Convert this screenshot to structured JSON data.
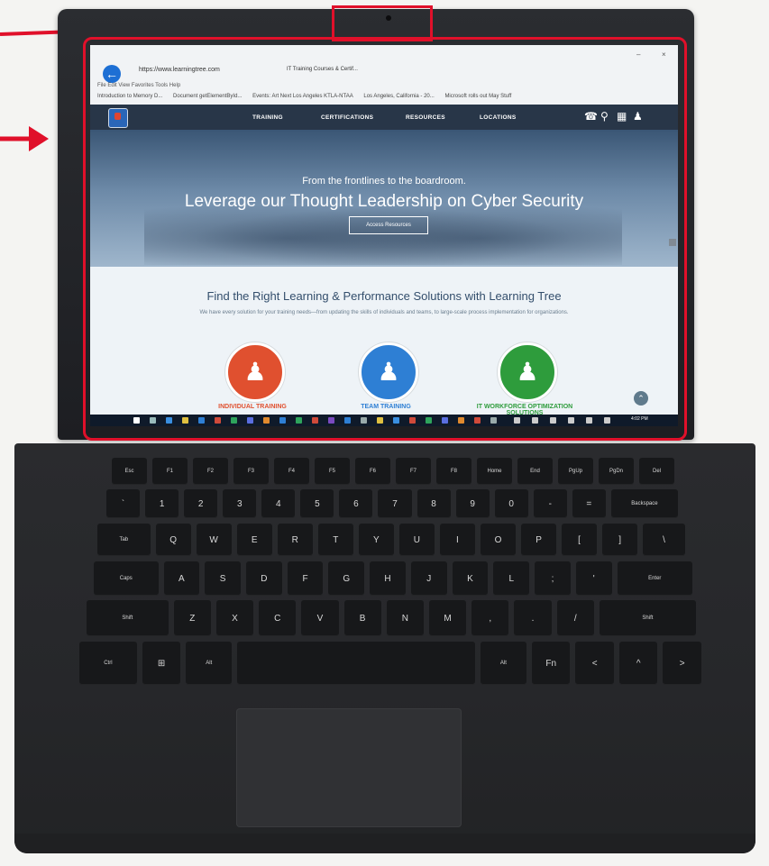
{
  "browser": {
    "url": "https://www.learningtree.com",
    "tab_title": "IT Training Courses & Certif...",
    "menu_bar": "File  Edit  View  Favorites  Tools  Help",
    "bookmarks": [
      "Introduction to Memory D...",
      "Document getElementById...",
      "Events: Art Next Los Angeles  KTLA-NTAA",
      "Los Angeles, California - 20...",
      "Microsoft rolls out May Stuff"
    ],
    "window_minimize": "–",
    "window_close": "×"
  },
  "site": {
    "nav": [
      "TRAINING",
      "CERTIFICATIONS",
      "RESOURCES",
      "LOCATIONS"
    ],
    "nav_icons": [
      "phone-icon",
      "search-icon",
      "calendar-icon",
      "user-icon"
    ],
    "hero_subtitle": "From the frontlines to the boardroom.",
    "hero_title": "Leverage our Thought Leadership on Cyber Security",
    "hero_button": "Access Resources",
    "section_title": "Find the Right Learning & Performance Solutions with Learning Tree",
    "section_desc": "We have every solution for your training needs—from updating the skills of individuals and teams, to large-scale process implementation for organizations.",
    "solutions": [
      {
        "label": "INDIVIDUAL TRAINING",
        "color": "#e0502f"
      },
      {
        "label": "TEAM TRAINING",
        "color": "#2e7fd4"
      },
      {
        "label": "IT WORKFORCE OPTIMIZATION SOLUTIONS",
        "color": "#2e9c3c"
      }
    ]
  },
  "taskbar": {
    "clock": "4:02 PM"
  },
  "keyboard": {
    "rows": [
      [
        "Esc",
        "F1",
        "F2",
        "F3",
        "F4",
        "F5",
        "F6",
        "F7",
        "F8",
        "Home",
        "End",
        "PgUp",
        "PgDn",
        "Del"
      ],
      [
        "`",
        "1",
        "2",
        "3",
        "4",
        "5",
        "6",
        "7",
        "8",
        "9",
        "0",
        "-",
        "=",
        "Backspace"
      ],
      [
        "Tab",
        "Q",
        "W",
        "E",
        "R",
        "T",
        "Y",
        "U",
        "I",
        "O",
        "P",
        "[",
        "]",
        "\\"
      ],
      [
        "Caps",
        "A",
        "S",
        "D",
        "F",
        "G",
        "H",
        "J",
        "K",
        "L",
        ";",
        "'",
        "Enter"
      ],
      [
        "Shift",
        "Z",
        "X",
        "C",
        "V",
        "B",
        "N",
        "M",
        ",",
        ".",
        "/",
        "Shift"
      ],
      [
        "Ctrl",
        "⊞",
        "Alt",
        "",
        "Alt",
        "Fn",
        "<",
        "^",
        ">"
      ]
    ]
  },
  "colors": {
    "annotation": "#e0102a"
  }
}
